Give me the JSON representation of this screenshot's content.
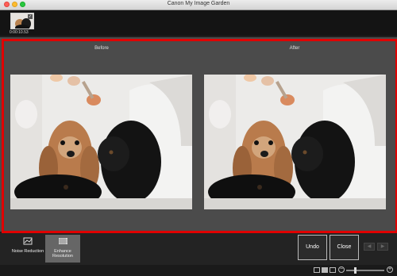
{
  "window": {
    "title": "Canon My Image Garden"
  },
  "thumbnail": {
    "time": "0:00:10.53",
    "selected": true
  },
  "preview": {
    "before_label": "Before",
    "after_label": "After"
  },
  "tools": [
    {
      "label": "Noise Reduction",
      "active": false
    },
    {
      "label": "Enhance Resolution",
      "active": true
    }
  ],
  "buttons": {
    "undo": "Undo",
    "close": "Close"
  },
  "colors": {
    "highlight": "#e00000",
    "background": "#4b4b4b"
  }
}
